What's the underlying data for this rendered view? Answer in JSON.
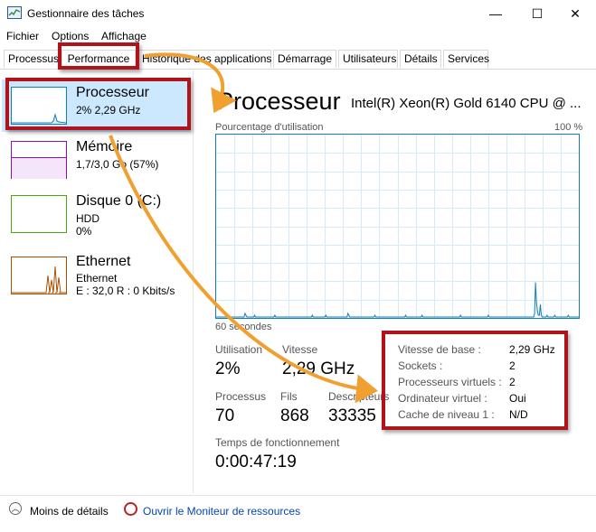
{
  "window": {
    "title": "Gestionnaire des tâches",
    "minimize_glyph": "—",
    "maximize_glyph": "☐",
    "close_glyph": "✕"
  },
  "menu": [
    "Fichier",
    "Options",
    "Affichage"
  ],
  "tabs": [
    {
      "label": "Processus"
    },
    {
      "label": "Performance",
      "active": true
    },
    {
      "label": "Historique des applications"
    },
    {
      "label": "Démarrage"
    },
    {
      "label": "Utilisateurs"
    },
    {
      "label": "Détails"
    },
    {
      "label": "Services"
    }
  ],
  "sidebar": [
    {
      "title": "Processeur",
      "line1": "2%  2,29 GHz",
      "line2": "",
      "color": "#117dbb",
      "selected": true
    },
    {
      "title": "Mémoire",
      "line1": "1,7/3,0 Go (57%)",
      "line2": "",
      "color": "#8b12ae"
    },
    {
      "title": "Disque 0 (C:)",
      "line1": "HDD",
      "line2": "0%",
      "color": "#4da60c"
    },
    {
      "title": "Ethernet",
      "line1": "Ethernet",
      "line2": "E : 32,0  R : 0 Kbits/s",
      "color": "#a74f01"
    }
  ],
  "main": {
    "heading": "Processeur",
    "model": "Intel(R) Xeon(R) Gold 6140 CPU @ ...",
    "graph_label": "Pourcentage d'utilisation",
    "graph_max": "100 %",
    "graph_time": "60 secondes",
    "utilization_label": "Utilisation",
    "utilization_value": "2%",
    "speed_label": "Vitesse",
    "speed_value": "2,29 GHz",
    "processes_label": "Processus",
    "processes_value": "70",
    "threads_label": "Fils",
    "threads_value": "868",
    "handles_label": "Descripteurs",
    "handles_value": "33335",
    "uptime_label": "Temps de fonctionnement",
    "uptime_value": "0:00:47:19",
    "properties": [
      {
        "label": "Vitesse de base :",
        "value": "2,29 GHz"
      },
      {
        "label": "Sockets :",
        "value": "2"
      },
      {
        "label": "Processeurs virtuels :",
        "value": "2"
      },
      {
        "label": "Ordinateur virtuel :",
        "value": "Oui"
      },
      {
        "label": "Cache de niveau 1 :",
        "value": "N/D"
      }
    ]
  },
  "footer": {
    "less_details": "Moins de détails",
    "resource_monitor": "Ouvrir le Moniteur de ressources"
  },
  "cpu_history": [
    0,
    0,
    0,
    0,
    0,
    0,
    0,
    0,
    0,
    0,
    0,
    0,
    0,
    0,
    0,
    0,
    0,
    0,
    0,
    0,
    0,
    0,
    0,
    0,
    0,
    0,
    0,
    0,
    0,
    0,
    2,
    1,
    0,
    0,
    0,
    0,
    0,
    0,
    0,
    0,
    1,
    0,
    0,
    0,
    0,
    0,
    0,
    0,
    0,
    0,
    0,
    0,
    0,
    0,
    0,
    0,
    0,
    0,
    0,
    0,
    0,
    1,
    0,
    0,
    0,
    0,
    0,
    0,
    0,
    0,
    0,
    0,
    0,
    0,
    0,
    0,
    0,
    0,
    0,
    0,
    0,
    0,
    0,
    0,
    0,
    0,
    0,
    0,
    0,
    0,
    0,
    0,
    0,
    0,
    0,
    0,
    0,
    0,
    0,
    0,
    1,
    0,
    0,
    0,
    0,
    0,
    0,
    0,
    0,
    0,
    0,
    0,
    0,
    0,
    1,
    0,
    0,
    0,
    0,
    0,
    0,
    0,
    0,
    0,
    0,
    0,
    0,
    0,
    0,
    0,
    0,
    0,
    0,
    0,
    0,
    0,
    0,
    2,
    1,
    0,
    0,
    0,
    0,
    0,
    0,
    0,
    0,
    0,
    0,
    0,
    0,
    0,
    0,
    0,
    0,
    0,
    0,
    0,
    0,
    0,
    0,
    0,
    0,
    0,
    0,
    1,
    0,
    0,
    0,
    0,
    0,
    0,
    0,
    0,
    0,
    0,
    0,
    0,
    0,
    0,
    0,
    0,
    0,
    0,
    0,
    0,
    0,
    0,
    0,
    0,
    0,
    0,
    0,
    0,
    0,
    0,
    0,
    1,
    0,
    0,
    0,
    0,
    0,
    0,
    0,
    0,
    0,
    0,
    0,
    0,
    0,
    0,
    0,
    0,
    1,
    0,
    0,
    0,
    0,
    0,
    0,
    0,
    0,
    0,
    0,
    0,
    0,
    0,
    0,
    0,
    0,
    0,
    0,
    0,
    0,
    0,
    0,
    0,
    0,
    0,
    0,
    0,
    0,
    0,
    0,
    0,
    0,
    0,
    0,
    0,
    0,
    0,
    0,
    0,
    1,
    0,
    0,
    0,
    0,
    0,
    0,
    0,
    0,
    0,
    0,
    0,
    0,
    0,
    0,
    0,
    0,
    0,
    0,
    0,
    0,
    0,
    0,
    0,
    0,
    0,
    0,
    0,
    0,
    1,
    0,
    0,
    0,
    0,
    0,
    0,
    0,
    0,
    0,
    0,
    0,
    0,
    0,
    0,
    0,
    0,
    0,
    0,
    0,
    0,
    0,
    0,
    0,
    0,
    0,
    0,
    0,
    0,
    0,
    0,
    0,
    0,
    0,
    0,
    0,
    0,
    0,
    0,
    0,
    0,
    0,
    0,
    0,
    0,
    0,
    0,
    0,
    2,
    19,
    8,
    3,
    1,
    1,
    7,
    1,
    0,
    0,
    0,
    0,
    0,
    1,
    0,
    0,
    0,
    0,
    0,
    0,
    0,
    1,
    0,
    0,
    0,
    0,
    0,
    0,
    0,
    0,
    0,
    0,
    0,
    0,
    0,
    1,
    0,
    0,
    0,
    0,
    0,
    0,
    0,
    0,
    0,
    0,
    0
  ]
}
